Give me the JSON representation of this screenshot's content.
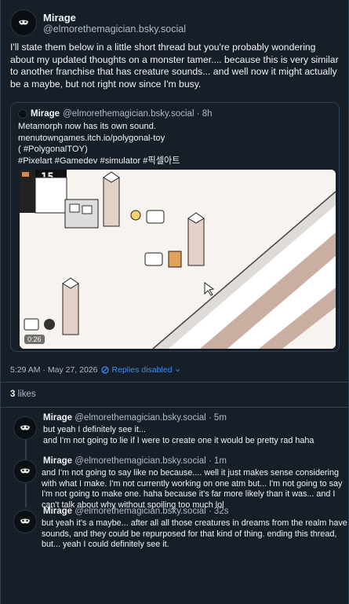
{
  "post": {
    "display_name": "Mirage",
    "handle": "@elmorethemagician.bsky.social",
    "text": "I'll state them below in a little short thread but you're probably wondering about my updated thoughts on a monster tamer.... because this is very similar to another franchise that has creature sounds... and well now it might actually be a maybe, but not right now since I'm busy.",
    "timestamp": "5:29 AM · May 27, 2026",
    "replies_label": "Replies disabled",
    "likes_count": "3",
    "likes_label": "likes"
  },
  "quote": {
    "display_name": "Mirage",
    "handle": "@elmorethemagician.bsky.social · 8h",
    "lines": [
      "Metamorph now has its own sound.",
      "menutowngames.itch.io/polygonal-toy",
      "( #PolygonalTOY)",
      "#Pixelart #Gamedev #simulator #픽셀아트"
    ],
    "video_time": "0:26",
    "hud_value": "15"
  },
  "replies": [
    {
      "display_name": "Mirage",
      "handle": "@elmorethemagician.bsky.social · 5m",
      "text": "but yeah I definitely see it...\nand I'm not going to lie if I were to create one it would be pretty rad haha"
    },
    {
      "display_name": "Mirage",
      "handle": "@elmorethemagician.bsky.social · 1m",
      "text": "and I'm not going to say like no because.... well it just makes sense considering with what I make. I'm not currently working on one atm but... I'm not going to say I'm not going to make one. haha because it's far more likely than it was... and I can't talk about why without spoiling too much lol"
    },
    {
      "display_name": "Mirage",
      "handle": "@elmorethemagician.bsky.social · 32s",
      "text": "but yeah it's a maybe... after all all those creatures in dreams from the realm have sounds, and they could be repurposed for that kind of thing. ending this thread, but... yeah I could definitely see it."
    }
  ],
  "icons": {
    "avatar": "mask-icon",
    "replies_disabled": "no-entry-icon",
    "dropdown": "chevron-down-icon"
  },
  "colors": {
    "background": "#161e27",
    "accent": "#3d8ef5",
    "muted": "#aebbc9"
  }
}
